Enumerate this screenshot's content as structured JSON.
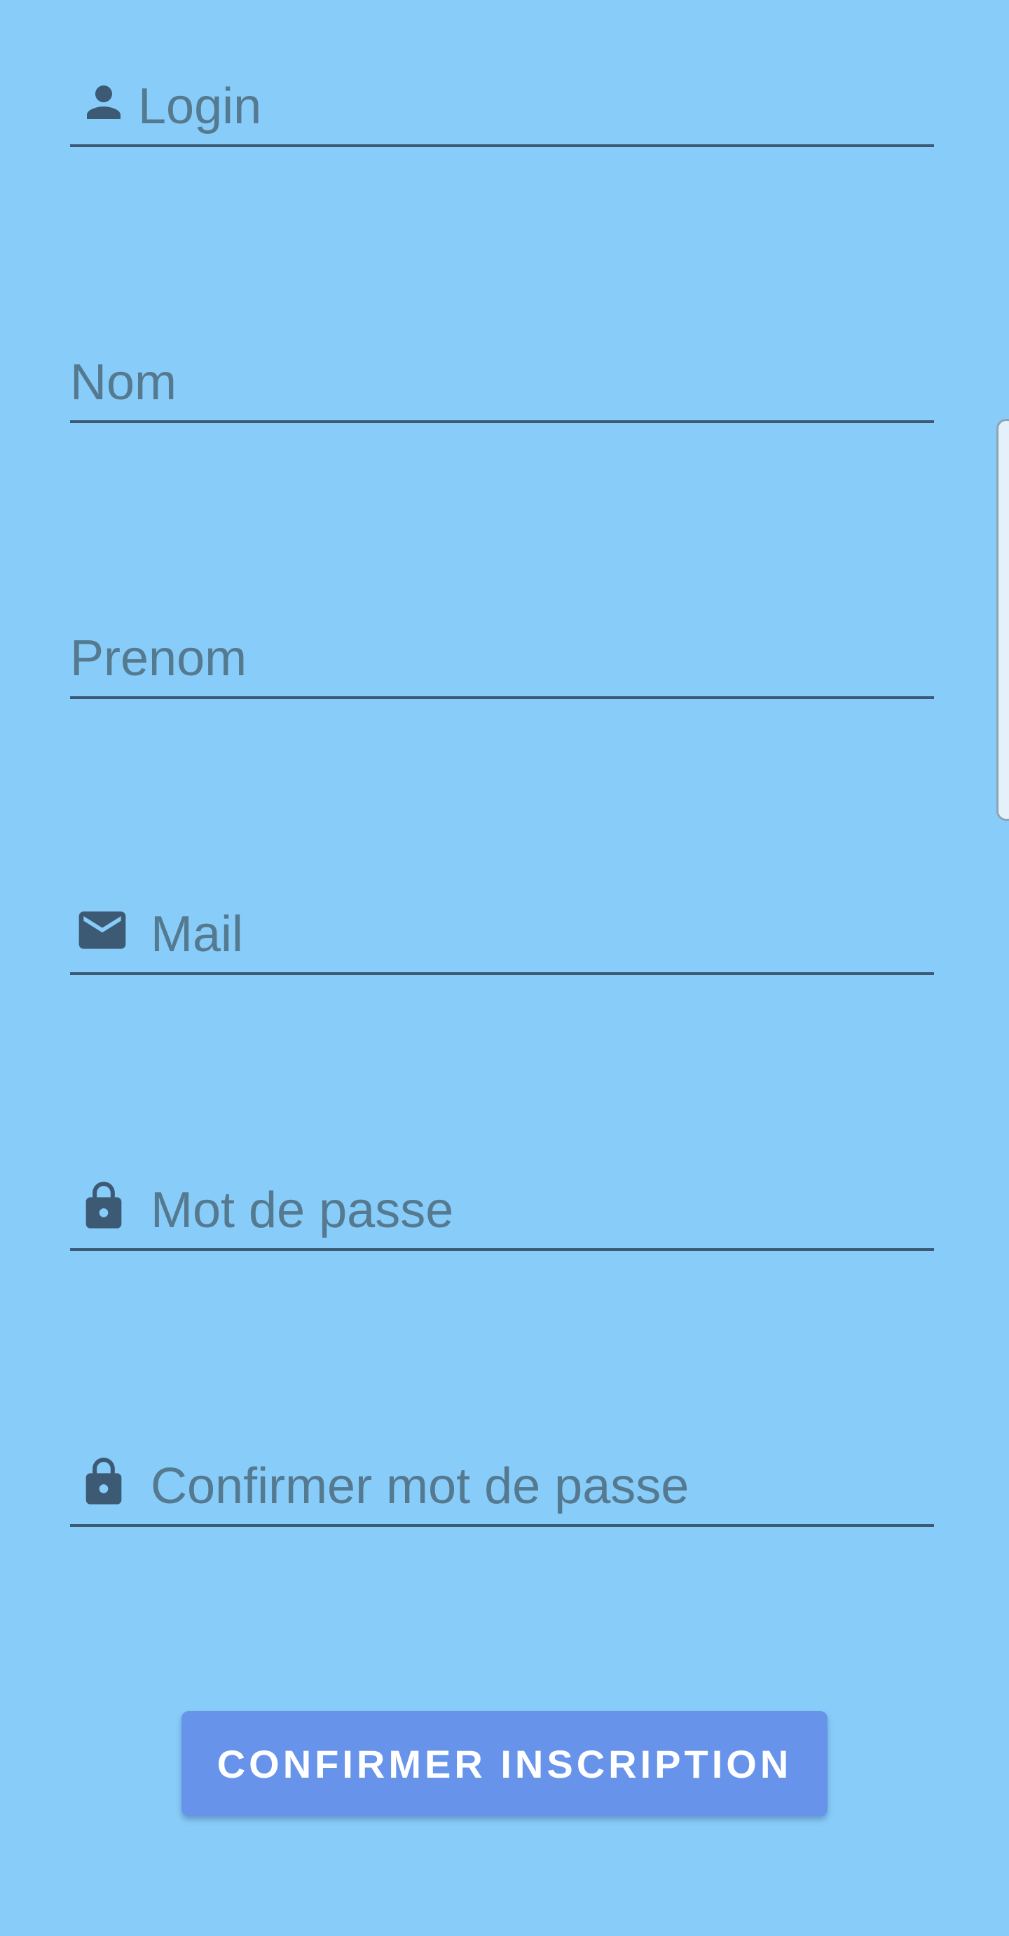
{
  "theme": {
    "background": "#88CCF9",
    "field_line": "#3C5A73",
    "icon_color": "#3C5A73",
    "placeholder_color": "#55798F",
    "button_color": "#6794EA",
    "button_text_color": "#FFFFFF"
  },
  "form": {
    "fields": [
      {
        "id": "login",
        "placeholder": "Login",
        "value": "",
        "icon": "person-icon"
      },
      {
        "id": "nom",
        "placeholder": "Nom",
        "value": "",
        "icon": null
      },
      {
        "id": "prenom",
        "placeholder": "Prenom",
        "value": "",
        "icon": null
      },
      {
        "id": "mail",
        "placeholder": "Mail",
        "value": "",
        "icon": "mail-icon"
      },
      {
        "id": "password",
        "placeholder": "Mot de passe",
        "value": "",
        "icon": "lock-icon"
      },
      {
        "id": "confirm_password",
        "placeholder": "Confirmer mot de passe",
        "value": "",
        "icon": "lock-icon"
      }
    ],
    "submit_label": "CONFIRMER INSCRIPTION"
  }
}
